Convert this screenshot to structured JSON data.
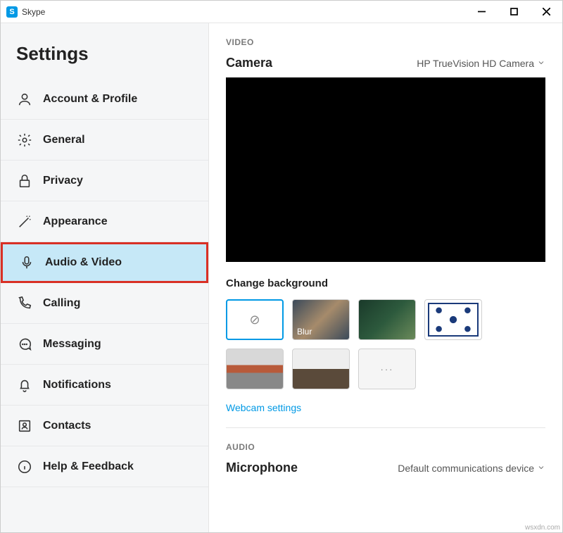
{
  "app": {
    "name": "Skype",
    "icon_letter": "S"
  },
  "sidebar": {
    "title": "Settings",
    "items": [
      {
        "label": "Account & Profile",
        "icon": "user"
      },
      {
        "label": "General",
        "icon": "gear"
      },
      {
        "label": "Privacy",
        "icon": "lock"
      },
      {
        "label": "Appearance",
        "icon": "wand"
      },
      {
        "label": "Audio & Video",
        "icon": "mic",
        "selected": true
      },
      {
        "label": "Calling",
        "icon": "phone"
      },
      {
        "label": "Messaging",
        "icon": "chat"
      },
      {
        "label": "Notifications",
        "icon": "bell"
      },
      {
        "label": "Contacts",
        "icon": "contacts"
      },
      {
        "label": "Help & Feedback",
        "icon": "info"
      }
    ]
  },
  "main": {
    "video_section": "VIDEO",
    "camera_label": "Camera",
    "camera_value": "HP TrueVision HD Camera",
    "change_bg": "Change background",
    "bg_blur_label": "Blur",
    "bg_more_label": "···",
    "webcam_link": "Webcam settings",
    "audio_section": "AUDIO",
    "mic_label": "Microphone",
    "mic_value": "Default communications device"
  },
  "watermark": "wsxdn.com"
}
